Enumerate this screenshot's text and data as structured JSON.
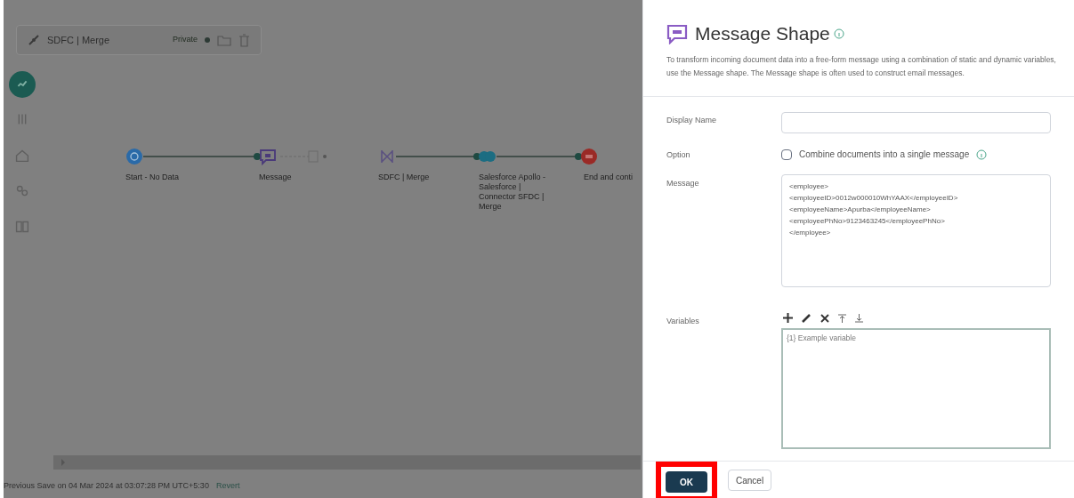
{
  "process": {
    "title": "SDFC | Merge",
    "status": "Private"
  },
  "rail": [
    {
      "kind": "build",
      "selected": true
    },
    {
      "kind": "tune",
      "selected": false
    },
    {
      "kind": "home",
      "selected": false
    },
    {
      "kind": "people",
      "selected": false
    },
    {
      "kind": "book",
      "selected": false
    }
  ],
  "nodes": [
    {
      "kind": "start",
      "label": "Start - No Data"
    },
    {
      "kind": "message",
      "label": "Message"
    },
    {
      "kind": "map",
      "label": "SDFC | Merge"
    },
    {
      "kind": "connector",
      "label": "Salesforce Apollo - Salesforce | Connector SFDC | Merge"
    },
    {
      "kind": "end",
      "label": "End and conti"
    }
  ],
  "status_bar": {
    "text": "Previous Save on 04 Mar 2024 at 03:07:28 PM UTC+5:30",
    "link": "Revert"
  },
  "panel": {
    "title": "Message Shape",
    "description": "To transform incoming document data into a free-form message using a combination of static and dynamic variables, use the Message shape. The Message shape is often used to construct email messages.",
    "fields": [
      {
        "kind": "text",
        "label": "Display Name"
      },
      {
        "kind": "checkbox",
        "label": "Option",
        "text": "Combine documents into a single message",
        "checked": false
      },
      {
        "kind": "textarea",
        "label": "Message",
        "lines": [
          "<employee>",
          "<employeeID>0012w000010WhYAAX</employeeID>",
          "<employeeName>Apurba</employeeName>",
          "<employeePhNo>9123463245</employeePhNo>",
          "</employee>"
        ]
      },
      {
        "kind": "variables",
        "label": "Variables",
        "items": [
          "{1} Example variable"
        ]
      }
    ],
    "buttons": [
      {
        "label": "OK",
        "primary": true,
        "highlighted": true
      },
      {
        "label": "Cancel",
        "primary": false,
        "highlighted": false
      }
    ]
  }
}
